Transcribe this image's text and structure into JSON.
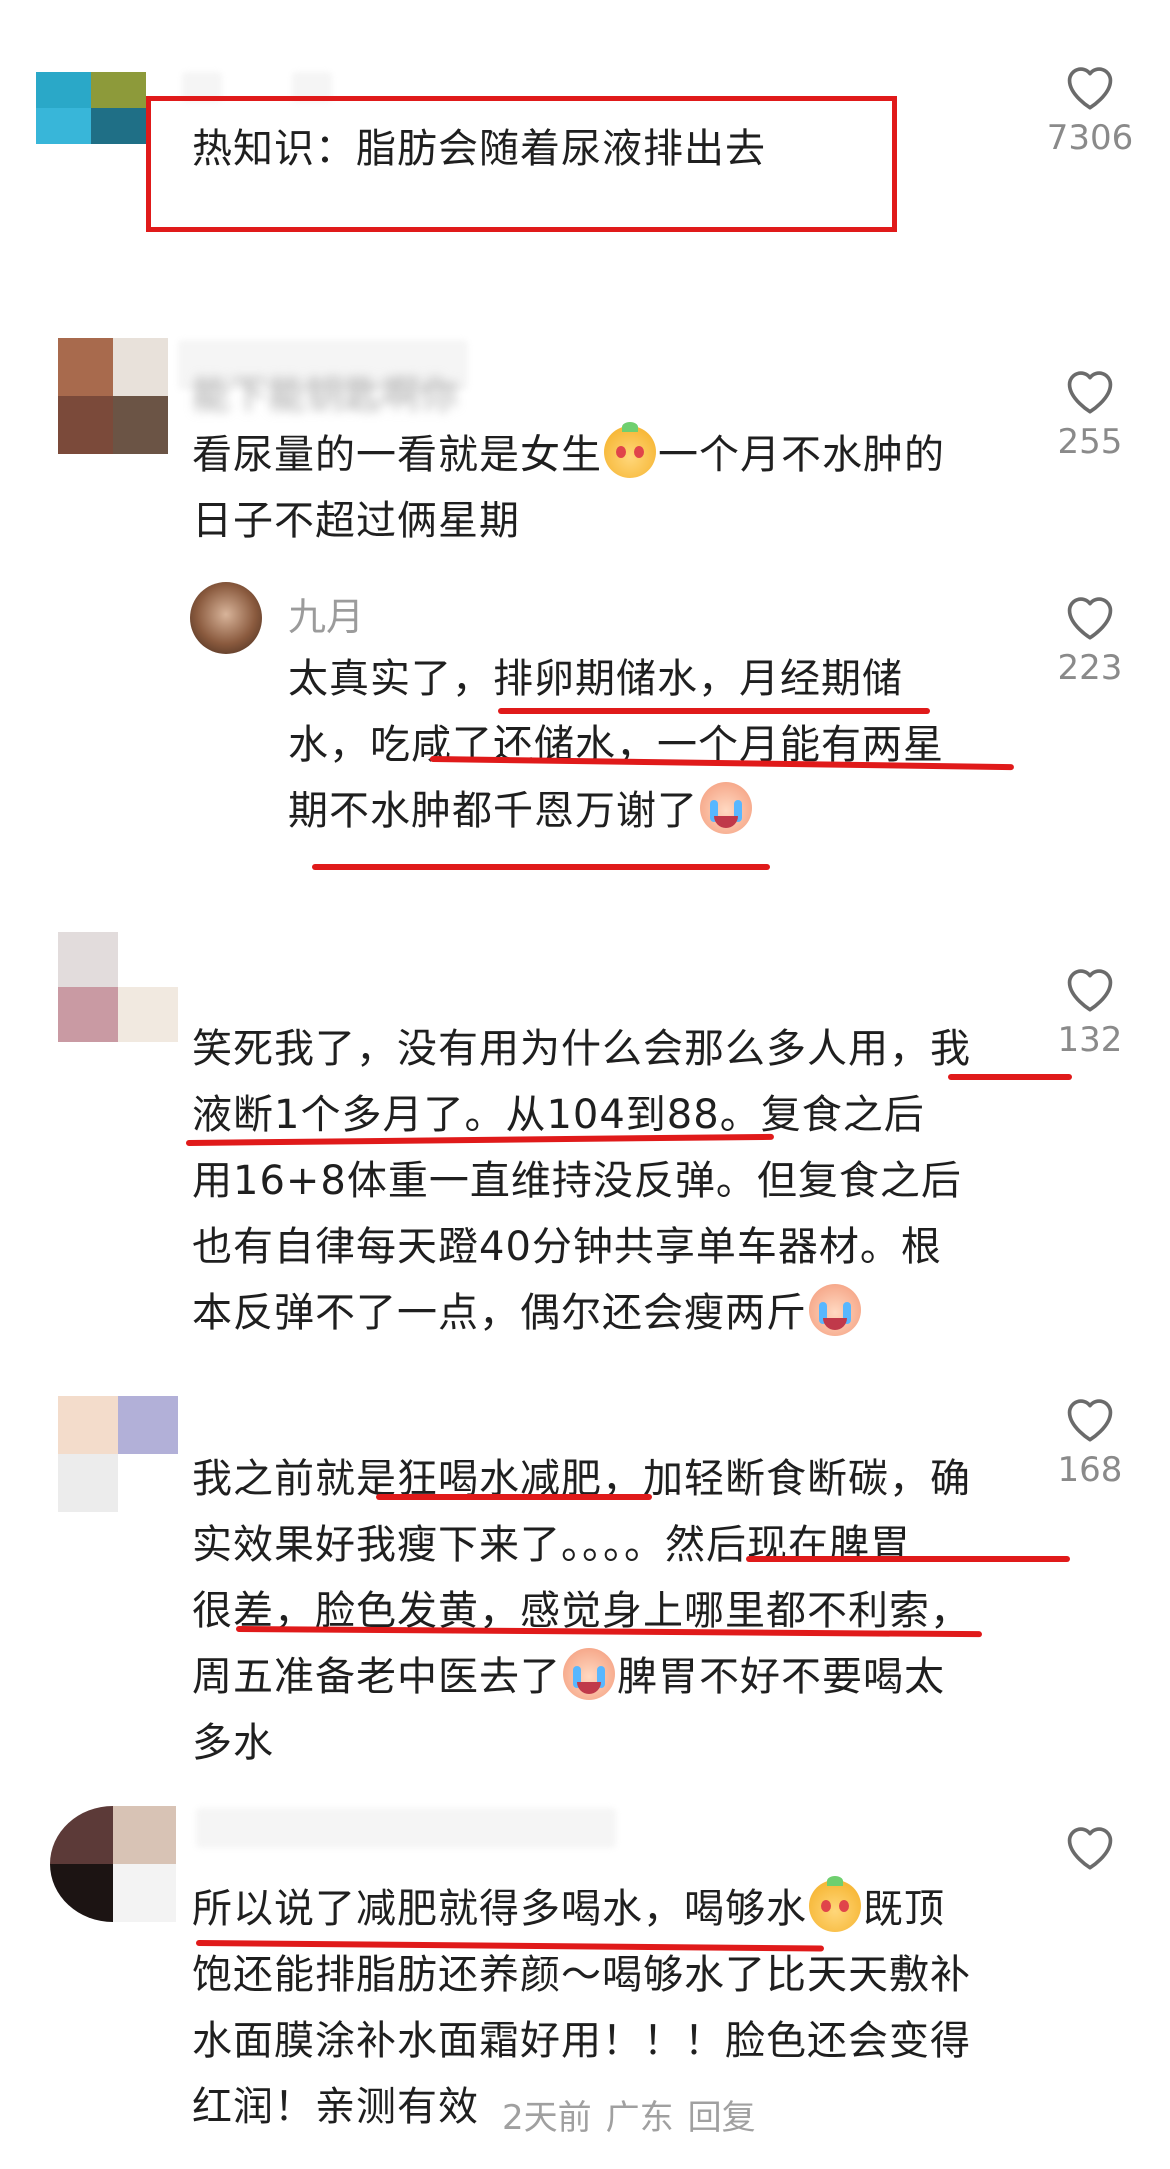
{
  "comments": [
    {
      "id": "c1",
      "username": "",
      "lines": [
        "热知识：脂肪会随着尿液排出去"
      ],
      "likes": "7306"
    },
    {
      "id": "c2",
      "username": "能下能钥匙啊你",
      "lines": [
        "看尿量的一看就是女生",
        "一个月不水肿的",
        "日子不超过俩星期"
      ],
      "emoji": "dog-face-emoji",
      "likes": "255"
    },
    {
      "id": "c3",
      "username": "九月",
      "lines": [
        "太真实了，排卵期储水，月经期储",
        "水，吃咸了还储水，一个月能有两星",
        "期不水肿都千恩万谢了"
      ],
      "emoji": "crying-face-emoji",
      "likes": "223"
    },
    {
      "id": "c4",
      "username": "",
      "lines": [
        "笑死我了，没有用为什么会那么多人用，我",
        "液断1个多月了。从104到88。复食之后",
        "用16+8体重一直维持没反弹。但复食之后",
        "也有自律每天蹬40分钟共享单车器材。根",
        "本反弹不了一点，偶尔还会瘦两斤"
      ],
      "emoji": "crying-face-emoji",
      "likes": "132"
    },
    {
      "id": "c5",
      "username": "",
      "lines": [
        "我之前就是狂喝水减肥，加轻断食断碳，确",
        "实效果好我瘦下来了。。。。然后现在脾胃",
        "很差，脸色发黄，感觉身上哪里都不利索，",
        "周五准备老中医去了",
        "脾胃不好不要喝太",
        "多水"
      ],
      "emoji": "crying-face-emoji",
      "likes": "168"
    },
    {
      "id": "c6",
      "username": "",
      "lines": [
        "所以说了减肥就得多喝水，喝够水",
        "既顶",
        "饱还能排脂肪还养颜～喝够水了比天天敷补",
        "水面膜涂补水面霜好用！！！脸色还会变得",
        "红润！亲测有效"
      ],
      "emoji": "dog-face-emoji",
      "likes": "",
      "meta": {
        "time": "2天前",
        "location": "广东",
        "reply": "回复"
      }
    }
  ],
  "colors": {
    "highlight_box": "#e01a1a",
    "underline": "#e01a1a",
    "text": "#1f1f1f",
    "count": "#8a8a8a"
  },
  "icons": [
    "heart-outline-icon",
    "dog-face-emoji",
    "crying-face-emoji"
  ]
}
